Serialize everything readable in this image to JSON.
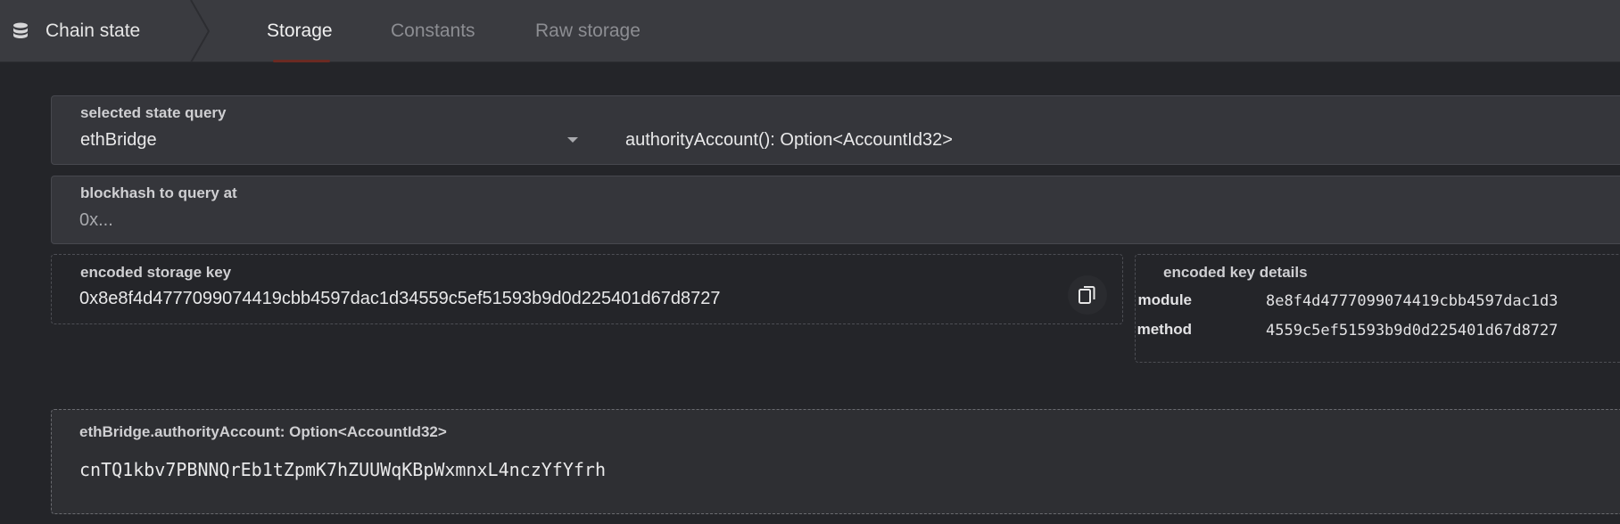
{
  "header": {
    "section_title": "Chain state",
    "section_icon": "database-icon",
    "tabs": [
      {
        "label": "Storage",
        "active": true
      },
      {
        "label": "Constants",
        "active": false
      },
      {
        "label": "Raw storage",
        "active": false
      }
    ]
  },
  "query": {
    "label": "selected state query",
    "module": "ethBridge",
    "method": "authorityAccount(): Option<AccountId32>"
  },
  "blockhash": {
    "label": "blockhash to query at",
    "placeholder": "0x..."
  },
  "encoded_key": {
    "label": "encoded storage key",
    "value": "0x8e8f4d4777099074419cbb4597dac1d34559c5ef51593b9d0d225401d67d8727",
    "copy_icon": "copy-icon"
  },
  "key_details": {
    "label": "encoded key details",
    "module_label": "module",
    "module_value": "8e8f4d4777099074419cbb4597dac1d3",
    "method_label": "method",
    "method_value": "4559c5ef51593b9d0d225401d67d8727"
  },
  "result": {
    "label": "ethBridge.authorityAccount: Option<AccountId32>",
    "value": "cnTQ1kbv7PBNNQrEb1tZpmK7hZUUWqKBpWxmnxL4nczYfYfrh"
  },
  "colors": {
    "background": "#242529",
    "topbar": "#3a3b40",
    "panel": "#35363b",
    "active_tab_indicator": "#6b2a22"
  }
}
